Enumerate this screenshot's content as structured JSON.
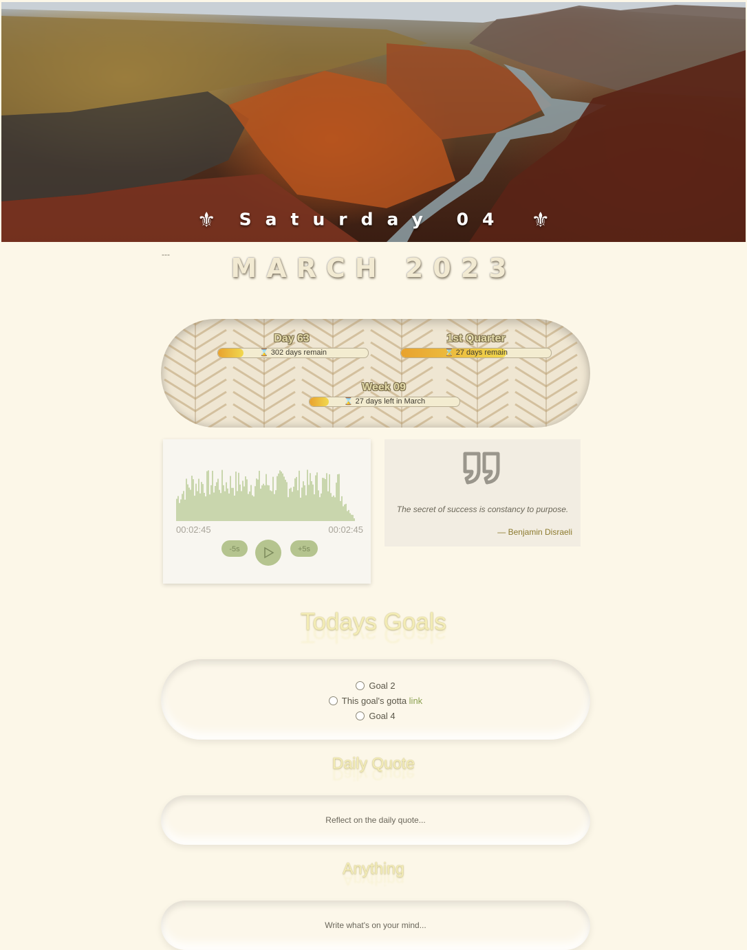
{
  "header": {
    "day_label": "Saturday 04",
    "fleur_left": "⚜",
    "fleur_right": "⚜",
    "dashes": "---",
    "month_title": "MARCH 2023"
  },
  "progress": {
    "day": {
      "title": "Day 63",
      "label": "302 days remain",
      "fraction": 0.17
    },
    "quarter": {
      "title": "1st Quarter",
      "label": "27 days remain",
      "fraction": 0.7
    },
    "week": {
      "title": "Week 09",
      "label": "27 days left in March",
      "fraction": 0.13
    },
    "bar_icon": "hourglass-icon"
  },
  "audio": {
    "current_time": "00:02:45",
    "total_time": "00:02:45",
    "rewind_label": "-5s",
    "forward_label": "+5s",
    "play_icon": "play-icon"
  },
  "quote": {
    "icon": "quote-icon",
    "text": "The secret of success is constancy to purpose.",
    "author": "— Benjamin Disraeli"
  },
  "goals": {
    "title": "Todays Goals",
    "items": [
      {
        "label": "Goal 2",
        "checked": false
      },
      {
        "label": "This goal's gotta ",
        "link": "link",
        "checked": false
      },
      {
        "label": "Goal 4",
        "checked": false
      }
    ]
  },
  "daily_quote": {
    "title": "Daily Quote",
    "placeholder": "Reflect on the daily quote..."
  },
  "anything": {
    "title": "Anything",
    "placeholder": "Write what's on your mind..."
  },
  "colors": {
    "background": "#fcf7e8",
    "accent_green": "#b5c48f",
    "bar_gold": "#e8a22e",
    "title_gold": "#f3ecb5"
  }
}
